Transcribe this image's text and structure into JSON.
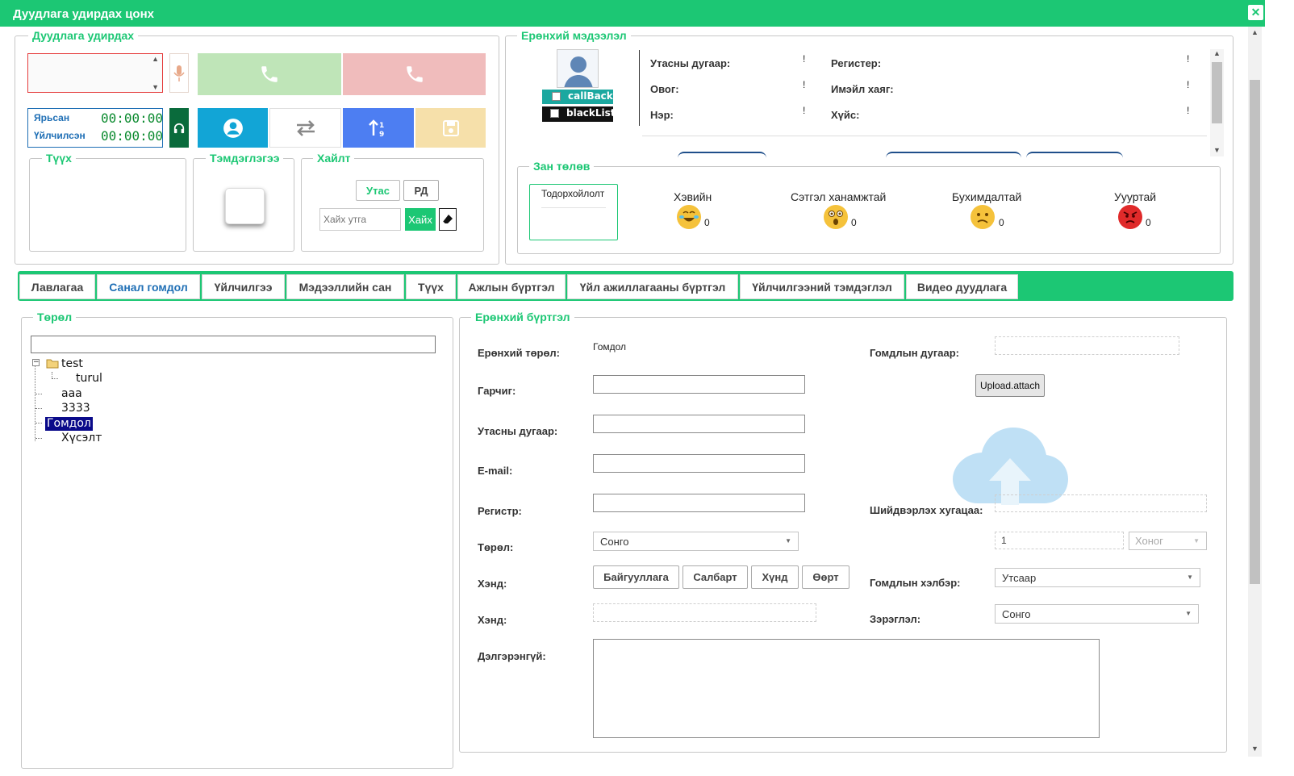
{
  "window": {
    "title": "Дуудлага удирдах цонх",
    "close": "✕"
  },
  "call_panel": {
    "legend": "Дуудлага удирдах",
    "timers": [
      {
        "label": "Ярьсан",
        "value": "00:00:00"
      },
      {
        "label": "Үйлчилсэн",
        "value": "00:00:00"
      }
    ],
    "history_legend": "Түүх",
    "note_legend": "Тэмдэглэгээ",
    "search": {
      "legend": "Хайлт",
      "tab_phone": "Утас",
      "tab_rd": "РД",
      "placeholder": "Хайх утга",
      "button": "Хайх"
    }
  },
  "general_info": {
    "legend": "Ерөнхий мэдээлэл",
    "callback_label": "callBack",
    "blacklist_label": "blackList",
    "fields_left": [
      {
        "label": "Утасны дугаар:",
        "value": "!"
      },
      {
        "label": "Овог:",
        "value": "!"
      },
      {
        "label": "Нэр:",
        "value": "!"
      }
    ],
    "fields_right": [
      {
        "label": "Регистер:",
        "value": "!"
      },
      {
        "label": "Имэйл хаяг:",
        "value": "!"
      },
      {
        "label": "Хүйс:",
        "value": "!"
      }
    ]
  },
  "mood": {
    "legend": "Зан төлөв",
    "undetermined": "Тодорхойлолт",
    "items": [
      {
        "label": "Хэвийн",
        "count": "0",
        "color": "#f5c23b"
      },
      {
        "label": "Сэтгэл ханамжтай",
        "count": "0",
        "color": "#f5c23b"
      },
      {
        "label": "Бухимдалтай",
        "count": "0",
        "color": "#f5c23b"
      },
      {
        "label": "Уууртай",
        "count": "0",
        "color": "#e02a2a"
      }
    ]
  },
  "tabs": [
    {
      "label": "Лавлагаа"
    },
    {
      "label": "Санал гомдол"
    },
    {
      "label": "Үйлчилгээ"
    },
    {
      "label": "Мэдээллийн сан"
    },
    {
      "label": "Түүх"
    },
    {
      "label": "Ажлын бүртгэл"
    },
    {
      "label": "Үйл ажиллагааны бүртгэл"
    },
    {
      "label": "Үйлчилгээний тэмдэглэл"
    },
    {
      "label": "Видео дуудлага"
    }
  ],
  "type_panel": {
    "legend": "Төрөл",
    "tree": {
      "root": "test",
      "child": "turul",
      "items": [
        "aaa",
        "3333",
        "Гомдол",
        "Хүсэлт"
      ],
      "selected": "Гомдол"
    }
  },
  "form": {
    "legend": "Ерөнхий бүртгэл",
    "general_type_label": "Ерөнхий төрөл:",
    "general_type_value": "Гомдол",
    "title_label": "Гарчиг:",
    "phone_label": "Утасны дугаар:",
    "email_label": "E-mail:",
    "register_label": "Регистр:",
    "type_label": "Төрөл:",
    "type_select": "Сонго",
    "scope_label": "Хэнд:",
    "scope_buttons": [
      "Байгууллага",
      "Салбарт",
      "Хүнд",
      "Өөрт"
    ],
    "scope2_label": "Хэнд:",
    "detail_label": "Дэлгэрэнгүй:",
    "complaint_no_label": "Гомдлын дугаар:",
    "upload_button": "Upload.attach",
    "deadline_label": "Шийдвэрлэх хугацаа:",
    "deadline_value": "1",
    "deadline_unit": "Хоног",
    "form_label": "Гомдлын хэлбэр:",
    "form_select": "Утсаар",
    "level_label": "Зэрэглэл:",
    "level_select": "Сонго"
  }
}
